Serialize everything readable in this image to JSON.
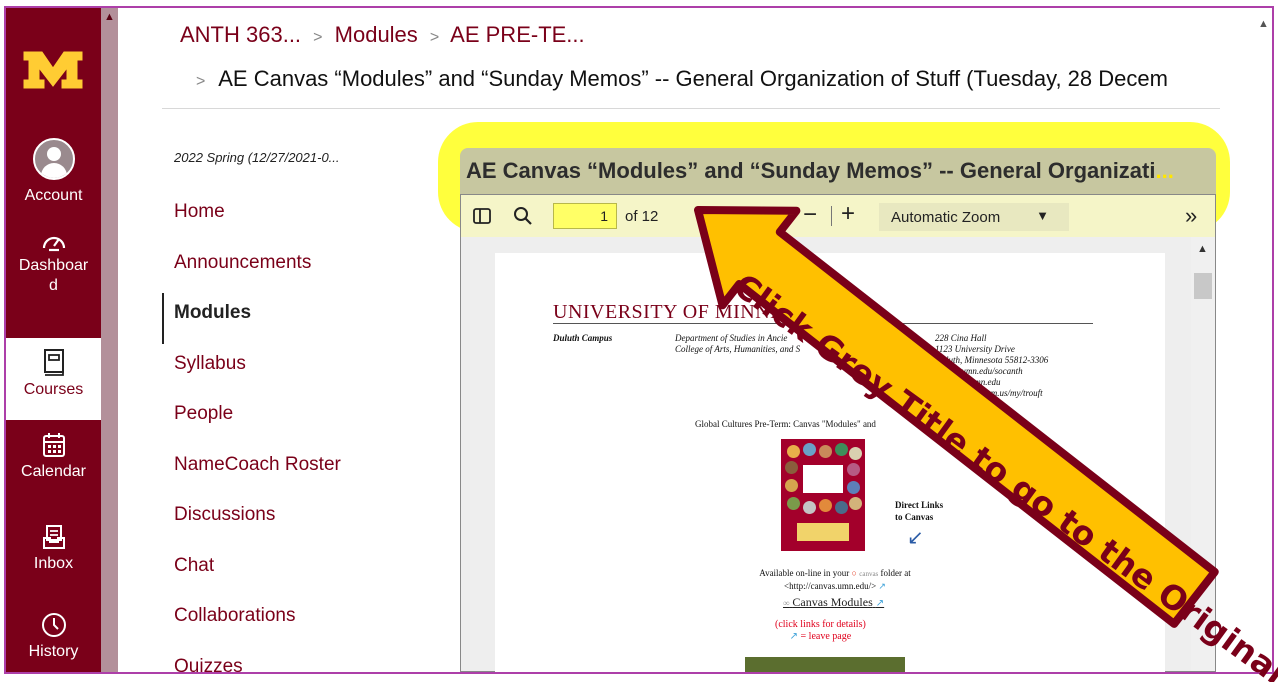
{
  "global_nav": {
    "logo_text": "M",
    "items": [
      {
        "label": "Account",
        "icon": "account-avatar-icon"
      },
      {
        "label": "Dashboard",
        "icon": "dashboard-icon"
      },
      {
        "label": "Courses",
        "icon": "courses-icon"
      },
      {
        "label": "Calendar",
        "icon": "calendar-icon"
      },
      {
        "label": "Inbox",
        "icon": "inbox-icon"
      },
      {
        "label": "History",
        "icon": "history-clock-icon"
      }
    ]
  },
  "breadcrumb": {
    "course": "ANTH 363...",
    "section": "Modules",
    "module": "AE PRE-TE...",
    "item": "AE Canvas “Modules” and “Sunday Memos” -- General Organization of Stuff (Tuesday, 28 Decem"
  },
  "course_nav": {
    "term": "2022 Spring (12/27/2021-0...",
    "items": [
      "Home",
      "Announcements",
      "Modules",
      "Syllabus",
      "People",
      "NameCoach Roster",
      "Discussions",
      "Chat",
      "Collaborations",
      "Quizzes"
    ],
    "active": "Modules"
  },
  "viewer": {
    "title": "AE Canvas “Modules” and “Sunday Memos” -- General Organizati",
    "title_ellipsis": "...",
    "page_current": "1",
    "page_total": "of 12",
    "zoom": "Automatic Zoom",
    "more": "»"
  },
  "document": {
    "university": "UNIVERSITY OF MINNESO",
    "campus": "Duluth Campus",
    "dept_lines": [
      "Department of Studies in Ancie",
      "College of Arts, Humanities, and S"
    ],
    "address_lines": [
      "228 Cina Hall",
      "1123 University Drive",
      "Duluth, Minnesota 55812-3306",
      "www.d.umn.edu/socanth",
      "troufi@d.umn.edu",
      "https://umn.zoom.us/my/trouft"
    ],
    "subtitle": "Global Cultures Pre-Term: Canvas \"Modules\" and",
    "direct_links": [
      "Direct Links",
      "to Canvas"
    ],
    "available": "Available on-line in your",
    "canvas_word": "canvas",
    "folder_at": "folder at",
    "canvas_url": "<http://canvas.umn.edu/>",
    "canvas_modules": "Canvas Modules",
    "click_links": "(click links for details)",
    "leave_page": "= leave page"
  },
  "annotation": {
    "text": "Click Grey Title to go to the Original",
    "fill_color": "#ffc000",
    "text_color": "#7a0019"
  },
  "colors": {
    "maroon": "#7a0019",
    "gold": "#ffcc33",
    "highlight": "#ffff33"
  }
}
